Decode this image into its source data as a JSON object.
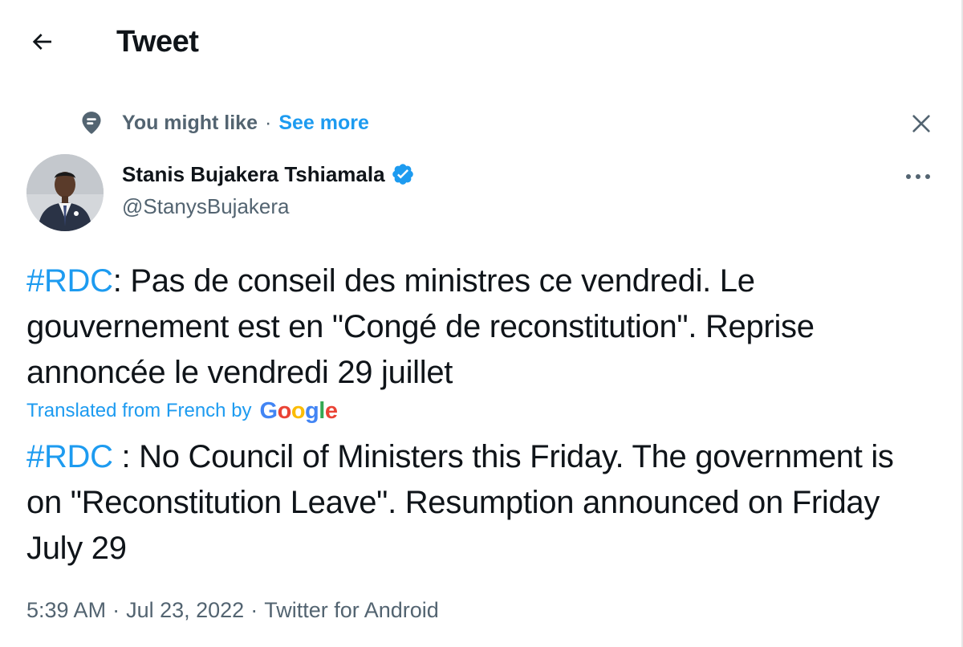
{
  "header": {
    "title": "Tweet",
    "back_icon": "arrow-left-icon"
  },
  "context": {
    "icon": "location-pin-icon",
    "label": "You might like",
    "separator": "·",
    "see_more": "See more",
    "close_icon": "close-icon"
  },
  "author": {
    "name": "Stanis Bujakera Tshiamala",
    "handle": "@StanysBujakera",
    "verified_icon": "verified-badge-icon",
    "more_icon": "more-horizontal-icon"
  },
  "tweet": {
    "hashtag": "#RDC",
    "text": ": Pas de conseil des ministres ce vendredi. Le gouvernement est en \"Congé de reconstitution\". Reprise annoncée le vendredi 29 juillet",
    "translated_label": "Translated from French by",
    "translator": "Google",
    "translation_hashtag": "#RDC",
    "translation_text": " : No Council of Ministers this Friday. The government is on \"Reconstitution Leave\". Resumption announced on Friday July 29"
  },
  "meta": {
    "time": "5:39 AM",
    "date": "Jul 23, 2022",
    "source": "Twitter for Android",
    "separator": "·"
  },
  "colors": {
    "accent": "#1d9bf0",
    "text": "#0f1419",
    "secondary": "#536471"
  }
}
